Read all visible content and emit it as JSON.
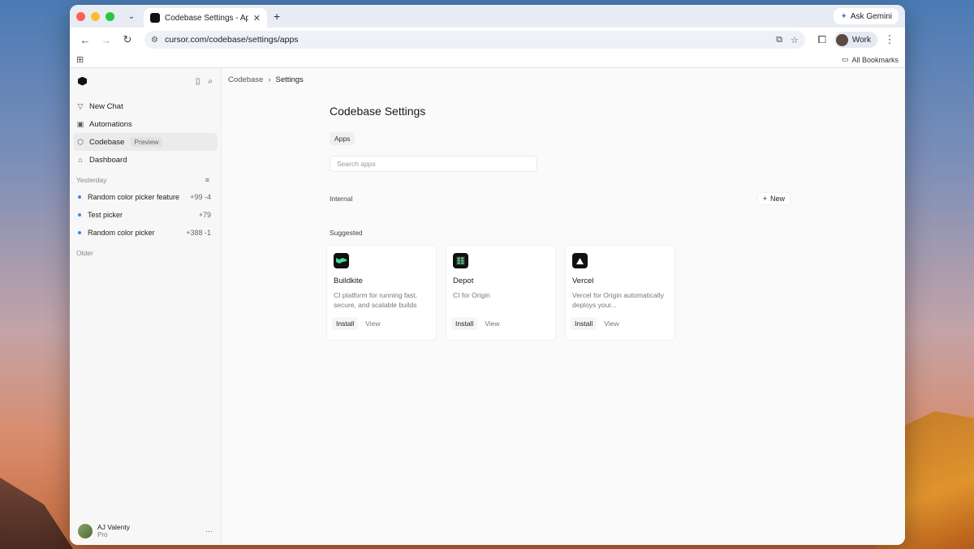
{
  "browser": {
    "tab_title": "Codebase Settings - Apps | C",
    "url": "cursor.com/codebase/settings/apps",
    "ask_gemini": "Ask Gemini",
    "profile": "Work",
    "all_bookmarks": "All Bookmarks"
  },
  "sidebar": {
    "nav": [
      {
        "label": "New Chat",
        "icon": "chat-icon"
      },
      {
        "label": "Automations",
        "icon": "robot-icon"
      },
      {
        "label": "Codebase",
        "icon": "cube-icon",
        "badge": "Preview"
      },
      {
        "label": "Dashboard",
        "icon": "home-icon"
      }
    ],
    "yesterday_label": "Yesterday",
    "chats": [
      {
        "title": "Random color picker feature",
        "stats": "+99 -4"
      },
      {
        "title": "Test picker",
        "stats": "+79"
      },
      {
        "title": "Random color picker",
        "stats": "+388 -1"
      }
    ],
    "older_label": "Older",
    "user": {
      "name": "AJ Valenty",
      "plan": "Pro"
    }
  },
  "breadcrumb": {
    "parent": "Codebase",
    "current": "Settings"
  },
  "main": {
    "title": "Codebase Settings",
    "tab_apps": "Apps",
    "search_placeholder": "Search apps",
    "internal_label": "Internal",
    "new_button": "New",
    "suggested_label": "Suggested",
    "apps": [
      {
        "name": "Buildkite",
        "description": "CI platform for running fast, secure, and scalable builds",
        "install": "Install",
        "view": "View",
        "icon_color": "#1f1f1f",
        "icon_accent": "#3ddc97"
      },
      {
        "name": "Depot",
        "description": "CI for Origin",
        "install": "Install",
        "view": "View",
        "icon_color": "#1f1f1f",
        "icon_accent": "#6fcf97"
      },
      {
        "name": "Vercel",
        "description": "Vercel for Origin automatically deploys your...",
        "install": "Install",
        "view": "View",
        "icon_color": "#000000",
        "icon_accent": "#ffffff"
      }
    ]
  }
}
